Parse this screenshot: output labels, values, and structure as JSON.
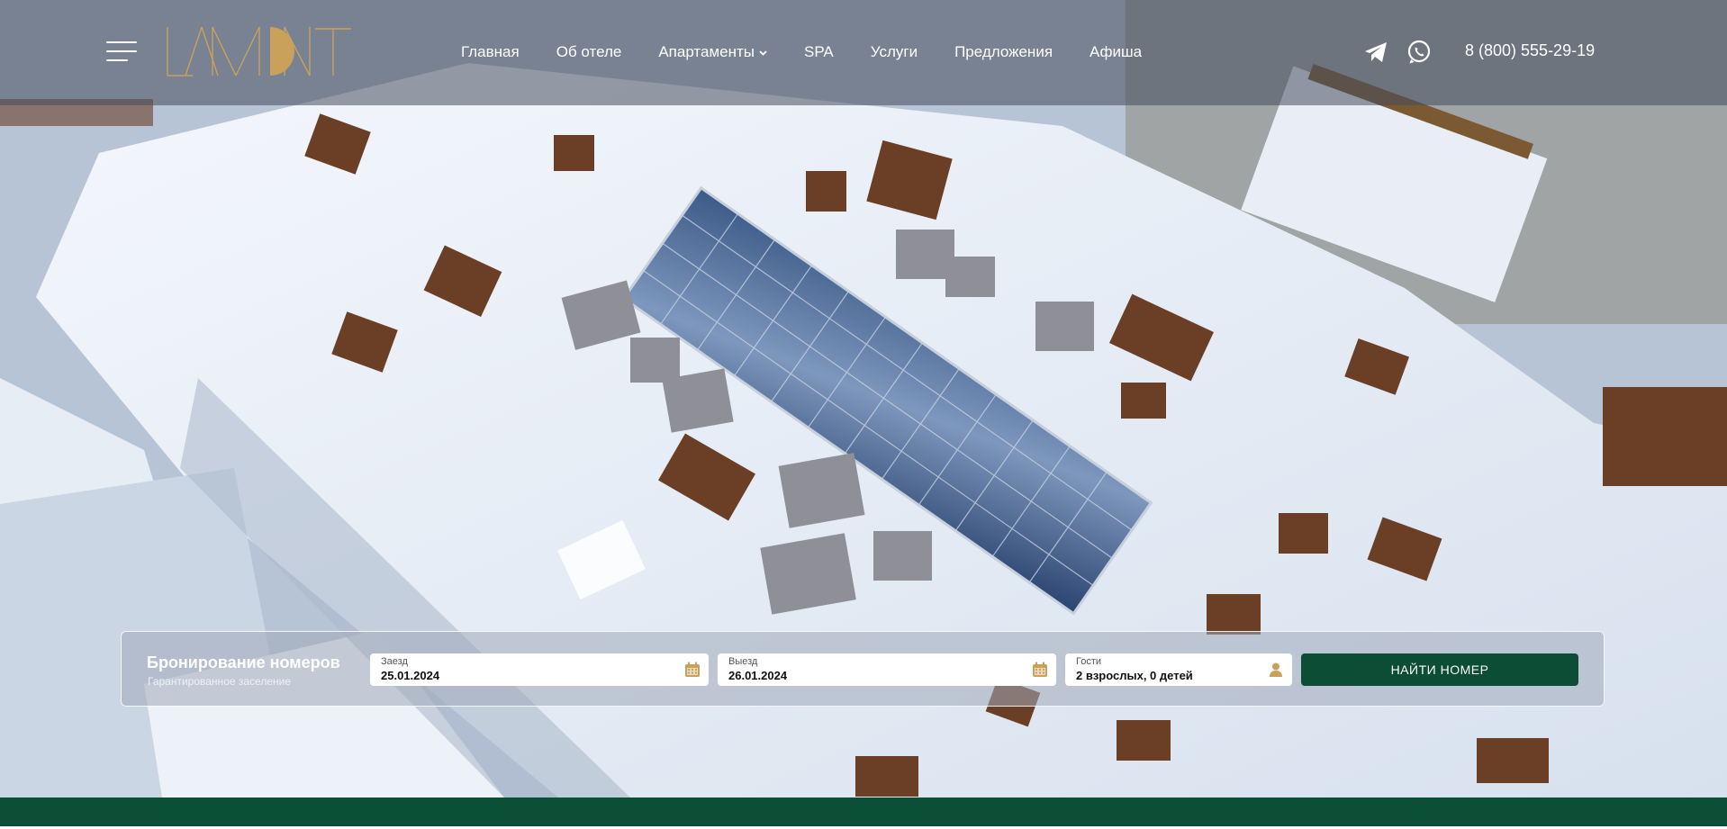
{
  "header": {
    "brand": "LAMONT",
    "nav": [
      {
        "label": "Главная"
      },
      {
        "label": "Об отеле"
      },
      {
        "label": "Апартаменты",
        "has_dropdown": true
      },
      {
        "label": "SPA"
      },
      {
        "label": "Услуги"
      },
      {
        "label": "Предложения"
      },
      {
        "label": "Афиша"
      }
    ],
    "social_icons": [
      "telegram-icon",
      "whatsapp-icon"
    ],
    "phone": "8 (800) 555-29-19"
  },
  "booking": {
    "title": "Бронирование номеров",
    "subtitle": "Гарантированное заселение",
    "checkin": {
      "label": "Заезд",
      "value": "25.01.2024",
      "icon": "calendar-icon"
    },
    "checkout": {
      "label": "Выезд",
      "value": "26.01.2024",
      "icon": "calendar-icon"
    },
    "guests": {
      "label": "Гости",
      "value": "2 взрослых, 0 детей",
      "icon": "person-icon"
    },
    "button": "НАЙТИ НОМЕР"
  },
  "colors": {
    "accent_green": "#0b4d35",
    "logo_gold": "#c9a15a",
    "header_overlay": "rgba(70,76,92,0.55)"
  }
}
